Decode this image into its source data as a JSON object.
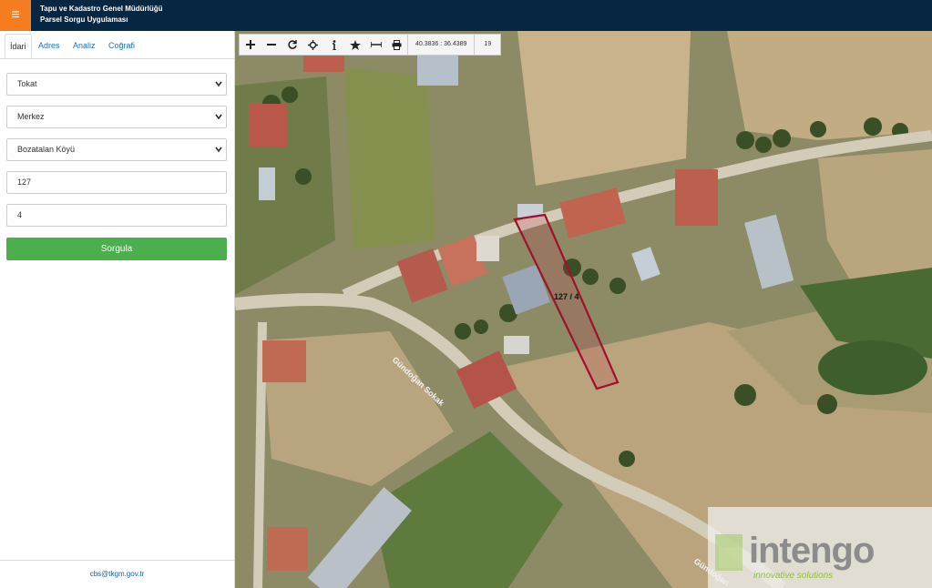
{
  "header": {
    "title_line1": "Tapu ve Kadastro Genel Müdürlüğü",
    "title_line2": "Parsel Sorgu Uygulaması",
    "menu_icon": "hamburger-icon",
    "menu_color": "#f57c1f",
    "bg_color": "#062642"
  },
  "sidebar": {
    "tabs": [
      {
        "label": "İdari",
        "active": true
      },
      {
        "label": "Adres",
        "active": false
      },
      {
        "label": "Analiz",
        "active": false
      },
      {
        "label": "Coğrafi",
        "active": false
      }
    ],
    "province": "Tokat",
    "district": "Merkez",
    "neighborhood": "Bozatalan Köyü",
    "block_no": "127",
    "parcel_no": "4",
    "query_button": "Sorgula",
    "footer_email": "cbs@tkgm.gov.tr",
    "button_color": "#4cae4c"
  },
  "map": {
    "toolbar": [
      "zoom-in-icon",
      "zoom-out-icon",
      "refresh-icon",
      "locate-icon",
      "info-icon",
      "bookmark-star-icon",
      "measure-icon",
      "print-icon"
    ],
    "coordinates": "40.3836 : 36.4389",
    "zoom_level": "19",
    "parcel_label": "127 / 4",
    "street_label_1": "Gündoğan Sokak",
    "street_label_2": "Gündoğan",
    "parcel_color": "#a0102a",
    "watermark": "intengo",
    "watermark_sub": "innovative solutions"
  }
}
